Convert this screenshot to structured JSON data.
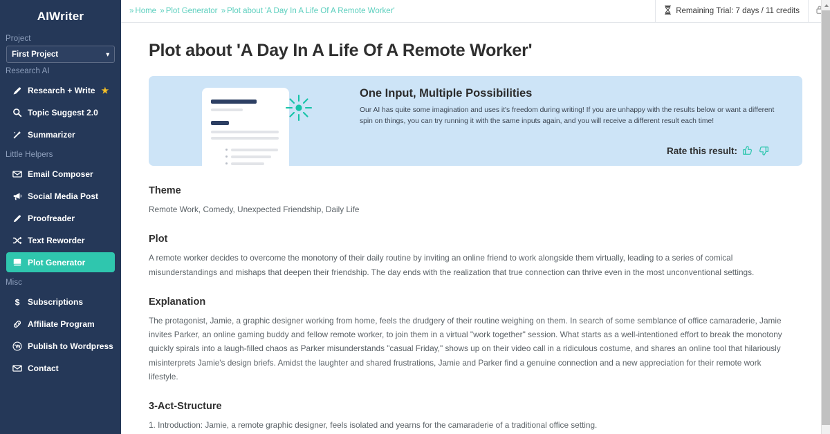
{
  "sidebar": {
    "brand": "AIWriter",
    "project_group_label": "Project",
    "project_select_value": "First Project",
    "groups": [
      {
        "label": "Research AI",
        "items": [
          {
            "label": "Research + Write",
            "icon": "pen-icon",
            "starred": true,
            "star": "★"
          },
          {
            "label": "Topic Suggest 2.0",
            "icon": "search-icon",
            "starred": false
          },
          {
            "label": "Summarizer",
            "icon": "magic-wand-icon",
            "starred": false
          }
        ]
      },
      {
        "label": "Little Helpers",
        "items": [
          {
            "label": "Email Composer",
            "icon": "envelope-icon",
            "starred": false
          },
          {
            "label": "Social Media Post",
            "icon": "megaphone-icon",
            "starred": false
          },
          {
            "label": "Proofreader",
            "icon": "pencil-icon",
            "starred": false
          },
          {
            "label": "Text Reworder",
            "icon": "shuffle-icon",
            "starred": false
          },
          {
            "label": "Plot Generator",
            "icon": "book-icon",
            "starred": false,
            "active": true
          }
        ]
      },
      {
        "label": "Misc",
        "items": [
          {
            "label": "Subscriptions",
            "icon": "dollar-icon",
            "starred": false
          },
          {
            "label": "Affiliate Program",
            "icon": "link-icon",
            "starred": false
          },
          {
            "label": "Publish to Wordpress",
            "icon": "wordpress-icon",
            "starred": false
          },
          {
            "label": "Contact",
            "icon": "envelope-icon",
            "starred": false
          }
        ]
      }
    ]
  },
  "topbar": {
    "breadcrumb": [
      {
        "label": "Home",
        "sep": "»"
      },
      {
        "label": "Plot Generator",
        "sep": "»"
      },
      {
        "label": "Plot about 'A Day In A Life Of A Remote Worker'",
        "sep": "»"
      }
    ],
    "trial_text": "Remaining Trial: 7 days / 11 credits",
    "trial_icon": "hourglass-icon",
    "user_icon": "lock-icon"
  },
  "page": {
    "title": "Plot about 'A Day In A Life Of A Remote Worker'"
  },
  "banner": {
    "title": "One Input, Multiple Possibilities",
    "text": "Our AI has quite some imagination and uses it's freedom during writing! If you are unhappy with the results below or want a different spin on things, you can try running it with the same inputs again, and you will receive a different result each time!",
    "rate_label": "Rate this result:",
    "thumb_up_icon": "thumbs-up-icon",
    "thumb_down_icon": "thumbs-down-icon",
    "illustration_icon": "document-sparkle-illustration"
  },
  "sections": [
    {
      "heading": "Theme",
      "body": "Remote Work, Comedy, Unexpected Friendship, Daily Life"
    },
    {
      "heading": "Plot",
      "body": "A remote worker decides to overcome the monotony of their daily routine by inviting an online friend to work alongside them virtually, leading to a series of comical misunderstandings and mishaps that deepen their friendship. The day ends with the realization that true connection can thrive even in the most unconventional settings."
    },
    {
      "heading": "Explanation",
      "body": "The protagonist, Jamie, a graphic designer working from home, feels the drudgery of their routine weighing on them. In search of some semblance of office camaraderie, Jamie invites Parker, an online gaming buddy and fellow remote worker, to join them in a virtual \"work together\" session. What starts as a well-intentioned effort to break the monotony quickly spirals into a laugh-filled chaos as Parker misunderstands \"casual Friday,\" shows up on their video call in a ridiculous costume, and shares an online tool that hilariously misinterprets Jamie's design briefs. Amidst the laughter and shared frustrations, Jamie and Parker find a genuine connection and a new appreciation for their remote work lifestyle."
    },
    {
      "heading": "3-Act-Structure",
      "body": "1. Introduction: Jamie, a remote graphic designer, feels isolated and yearns for the camaraderie of a traditional office setting."
    }
  ],
  "colors": {
    "sidebar_bg": "#253858",
    "accent_teal": "#2fc6ae",
    "breadcrumb_teal": "#5ccfbe",
    "banner_bg": "#cde4f7",
    "star_gold": "#f6c026"
  }
}
